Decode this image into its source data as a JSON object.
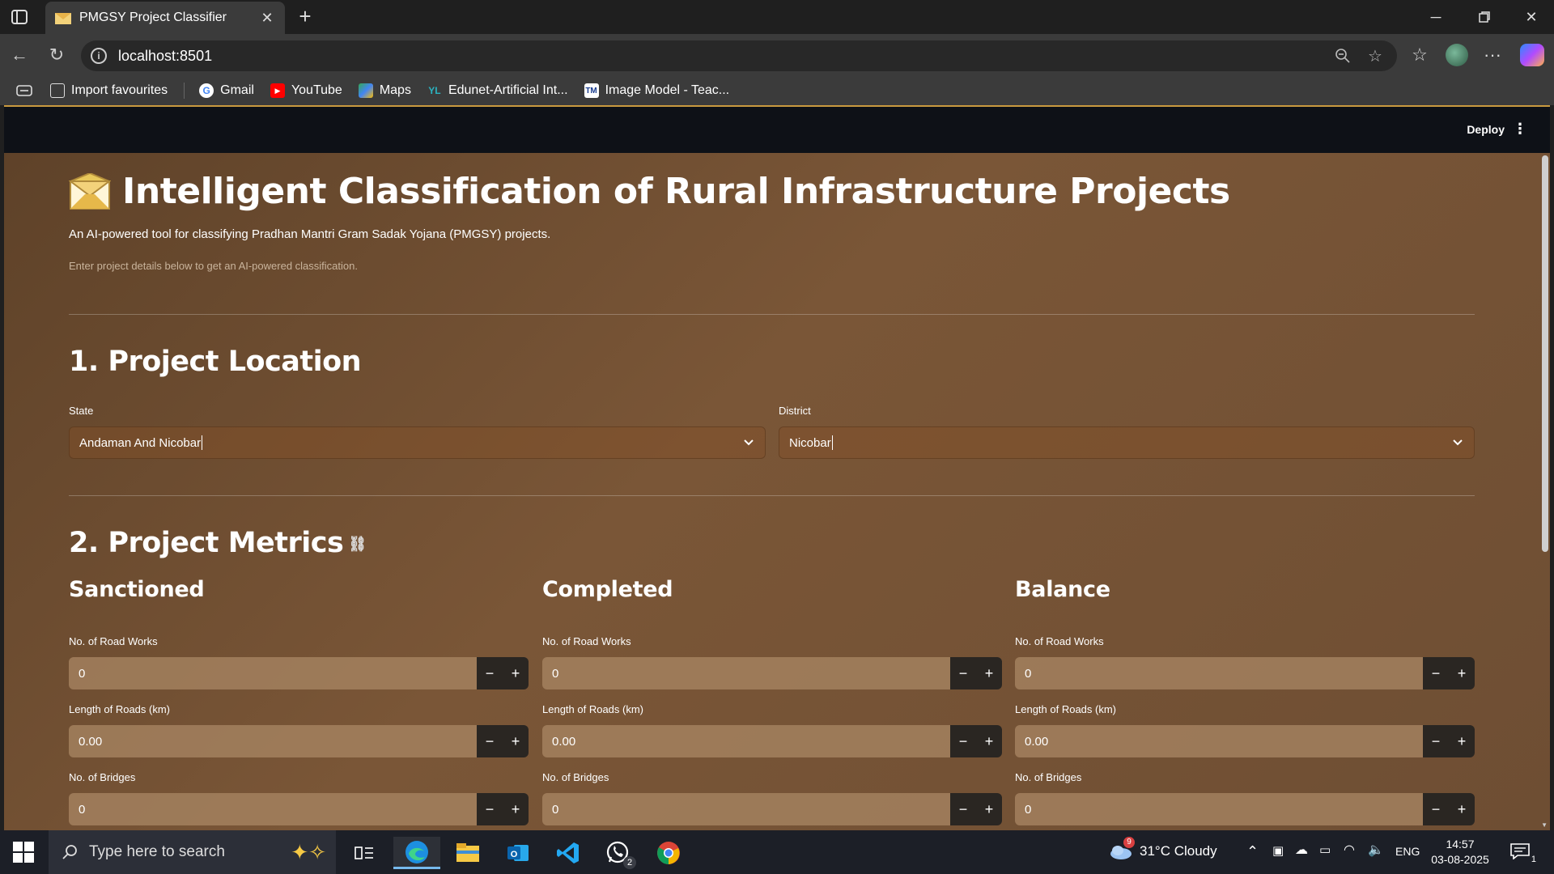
{
  "browser": {
    "tab_title": "PMGSY Project Classifier",
    "url": "localhost:8501",
    "favourites": [
      {
        "label": "Import favourites"
      },
      {
        "label": "Gmail"
      },
      {
        "label": "YouTube"
      },
      {
        "label": "Maps"
      },
      {
        "label": "Edunet-Artificial Int..."
      },
      {
        "label": "Image Model - Teac..."
      }
    ]
  },
  "app": {
    "deploy_label": "Deploy",
    "title": "Intelligent Classification of Rural Infrastructure Projects",
    "subtitle": "An AI-powered tool for classifying Pradhan Mantri Gram Sadak Yojana (PMGSY) projects.",
    "caption": "Enter project details below to get an AI-powered classification.",
    "location": {
      "heading": "1. Project Location",
      "state_label": "State",
      "state_value": "Andaman And Nicobar",
      "district_label": "District",
      "district_value": "Nicobar"
    },
    "metrics": {
      "heading": "2. Project Metrics",
      "columns": [
        {
          "heading": "Sanctioned",
          "fields": [
            {
              "label": "No. of Road Works",
              "value": "0"
            },
            {
              "label": "Length of Roads (km)",
              "value": "0.00"
            },
            {
              "label": "No. of Bridges",
              "value": "0"
            }
          ]
        },
        {
          "heading": "Completed",
          "fields": [
            {
              "label": "No. of Road Works",
              "value": "0"
            },
            {
              "label": "Length of Roads (km)",
              "value": "0.00"
            },
            {
              "label": "No. of Bridges",
              "value": "0"
            }
          ]
        },
        {
          "heading": "Balance",
          "fields": [
            {
              "label": "No. of Road Works",
              "value": "0"
            },
            {
              "label": "Length of Roads (km)",
              "value": "0.00"
            },
            {
              "label": "No. of Bridges",
              "value": "0"
            }
          ]
        }
      ],
      "minus_symbol": "−",
      "plus_symbol": "+"
    }
  },
  "taskbar": {
    "search_placeholder": "Type here to search",
    "weather": "31°C  Cloudy",
    "weather_badge": "9",
    "whatsapp_badge": "2",
    "language": "ENG",
    "time": "14:57",
    "date": "03-08-2025",
    "notification_count": "1"
  },
  "colors": {
    "app_background": "#6e4e33",
    "header_background": "#0e1117",
    "number_input_fill": "#aa8764",
    "stepper_button": "#2a2622"
  }
}
